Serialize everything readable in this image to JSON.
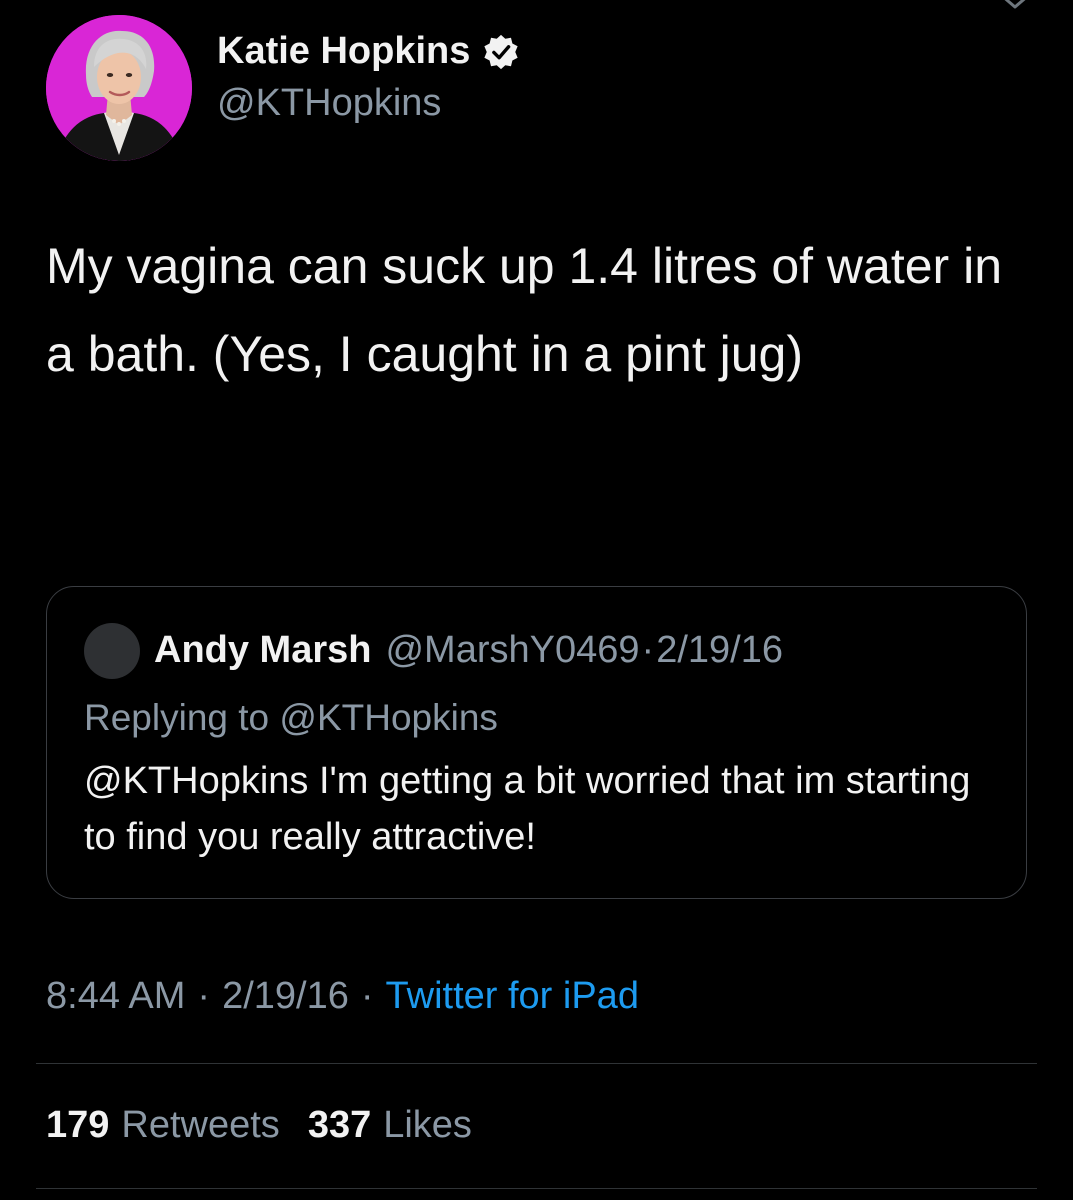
{
  "author": {
    "name": "Katie Hopkins",
    "handle": "@KTHopkins",
    "verified": true
  },
  "tweet": {
    "text": "My vagina can suck up 1.4 litres of water in a bath. (Yes, I caught in a pint jug)"
  },
  "quoted_tweet": {
    "name": "Andy Marsh",
    "handle": "@MarshY0469",
    "separator": "·",
    "date": "2/19/16",
    "replying_to": "Replying to @KTHopkins",
    "text": "@KTHopkins I'm getting a bit worried that im starting to find you really attractive!"
  },
  "meta": {
    "time": "8:44 AM",
    "separator": "·",
    "date": "2/19/16",
    "source": "Twitter for iPad"
  },
  "stats": {
    "retweets_count": "179",
    "retweets_label": "Retweets",
    "likes_count": "337",
    "likes_label": "Likes"
  },
  "icons": {
    "verified": "verified-badge-icon",
    "chevron": "chevron-down-icon"
  },
  "colors": {
    "background": "#000000",
    "text": "#f2f2f2",
    "secondary": "#8b98a5",
    "link": "#1d9bf0",
    "avatar_bg": "#d926d6"
  }
}
